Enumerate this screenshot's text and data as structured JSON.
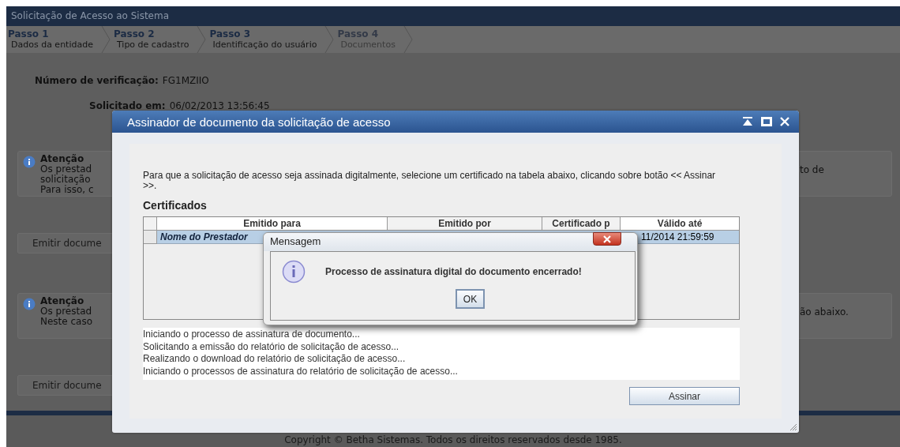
{
  "page": {
    "title": "Solicitação de Acesso ao Sistema",
    "steps": [
      {
        "step": "Passo 1",
        "label": "Dados da entidade",
        "disabled": false
      },
      {
        "step": "Passo 2",
        "label": "Tipo de cadastro",
        "disabled": false
      },
      {
        "step": "Passo 3",
        "label": "Identificação do usuário",
        "disabled": false
      },
      {
        "step": "Passo 4",
        "label": "Documentos",
        "disabled": true
      }
    ],
    "verification": {
      "label": "Número de verificação:",
      "value": "FG1MZIIO"
    },
    "requested": {
      "label": "Solicitado em:",
      "value": "06/02/2013 13:56:45"
    },
    "sections": [
      {
        "notice": {
          "title": "Atenção",
          "lines": [
            "Os prestad",
            "solicitação",
            "Para isso, c"
          ],
          "right_text": "to de"
        },
        "button": "Emitir docume"
      },
      {
        "notice": {
          "title": "Atenção",
          "lines": [
            "Os prestad",
            "Neste caso"
          ],
          "right_text": "ão abaixo."
        },
        "button": "Emitir docume"
      }
    ],
    "copyright": "Copyright © Betha Sistemas. Todos os direitos reservados desde 1985."
  },
  "dialog": {
    "title": "Assinador de documento da solicitação de acesso",
    "intro": "Para que a solicitação de acesso seja assinada digitalmente, selecione um certificado na tabela abaixo, clicando sobre botão << Assinar >>.",
    "section_title": "Certificados",
    "table": {
      "columns": [
        "Emitido para",
        "Emitido por",
        "Certificado p",
        "Válido até"
      ],
      "rows": [
        {
          "selected": true,
          "issued_to": "Nome do Prestador",
          "valid_until": "11/2014 21:59:59"
        }
      ]
    },
    "log": [
      "Iniciando o processo de assinatura de documento...",
      "Solicitando a emissão do relatório de solicitação de acesso...",
      "Realizando o download do relatório de solicitação de acesso...",
      "Iniciando o processos de assinatura do relatório de solicitação de acesso..."
    ],
    "button": "Assinar"
  },
  "message_box": {
    "title": "Mensagem",
    "text": "Processo de assinatura digital do documento encerrado!",
    "button": "OK"
  }
}
